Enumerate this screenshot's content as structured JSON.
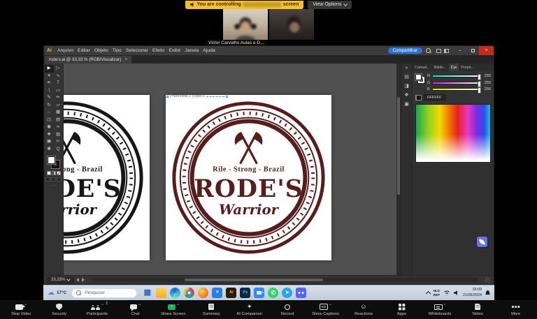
{
  "zoom_top": {
    "banner_prefix": "You are controlling",
    "banner_suffix": "screen",
    "view_options_label": "View Options",
    "participant_name": "Victor Carvalho Aulas e D..."
  },
  "illustrator": {
    "app_logo": "Ai",
    "menus": [
      "Arquivo",
      "Editar",
      "Objeto",
      "Tipo",
      "Selecionar",
      "Efeito",
      "Exibir",
      "Janela",
      "Ajuda"
    ],
    "share_button_label": "Compartilhar",
    "doc_tab_title": "rode's.ai @ 33,33 % (RGB/Visualizar)",
    "artboard_label": "Prancheta 1 cópia 6",
    "zoom_level": "33,33%",
    "panel_tabs": [
      "Camad...",
      "Biblio...",
      "Cor",
      "Propri..."
    ],
    "color_panel": {
      "channels": [
        {
          "label": "R",
          "value": "255"
        },
        {
          "label": "G",
          "value": "255"
        },
        {
          "label": "B",
          "value": "255"
        }
      ],
      "hex": "FFFFFF"
    },
    "tools": [
      "selection",
      "direct-selection",
      "magic-wand",
      "lasso",
      "pen",
      "type",
      "line-segment",
      "rectangle",
      "paintbrush",
      "pencil",
      "rotate",
      "scale",
      "width",
      "free-transform",
      "shape-builder",
      "gradient",
      "eyedropper",
      "blend",
      "symbol-sprayer",
      "graph",
      "artboard",
      "slice",
      "hand",
      "zoom"
    ],
    "logo": {
      "slogan": "Rile - Strong - Brazil",
      "title": "RODE'S",
      "subtitle": "Warrior"
    },
    "colors": {
      "logo_maroon": "#571d1d",
      "logo_black": "#161616",
      "share_button_blue": "#2f72d9"
    }
  },
  "taskbar": {
    "weather_temp": "17°C",
    "search_placeholder": "Pesquisar",
    "ai_label": "Ai",
    "ps_label": "Ps",
    "telegram_glyph": "➤",
    "whatsapp_glyph": "✆",
    "vscode_glyph": "V",
    "icons": [
      "task-view",
      "file-explorer",
      "edge",
      "chrome",
      "firefox",
      "vscode",
      "illustrator",
      "photoshop",
      "zoom",
      "whatsapp",
      "telegram",
      "discord"
    ],
    "tray": {
      "lang_line1": "NLD",
      "lang_line2": "REP",
      "time": "16:09",
      "date": "21/06/2024"
    }
  },
  "zoom_toolbar": {
    "items": [
      {
        "label": "Stop Video",
        "icon": "video-camera",
        "chevron": true
      },
      {
        "label": "Security",
        "icon": "shield"
      },
      {
        "label": "Participants",
        "icon": "participants",
        "badge": "2",
        "chevron": true
      },
      {
        "label": "Chat",
        "icon": "chat",
        "chevron": true
      },
      {
        "label": "Share Screen",
        "icon": "share-screen",
        "chevron": true,
        "accent": "#1fae5e",
        "arrow": "↑"
      },
      {
        "label": "Summary",
        "icon": "summary-doc"
      },
      {
        "label": "AI Companion",
        "icon": "ai-sparkle",
        "glyph": "✦"
      },
      {
        "label": "Record",
        "icon": "record"
      },
      {
        "label": "Show Captions",
        "icon": "captions",
        "icon_text": "CC",
        "chevron": true
      },
      {
        "label": "Reactions",
        "icon": "smiley",
        "glyph": "☺"
      },
      {
        "label": "Apps",
        "icon": "apps-grid"
      },
      {
        "label": "Whiteboards",
        "icon": "whiteboard",
        "chevron": true
      },
      {
        "label": "Notes",
        "icon": "notes-doc"
      },
      {
        "label": "More",
        "icon": "more-dots"
      }
    ]
  }
}
